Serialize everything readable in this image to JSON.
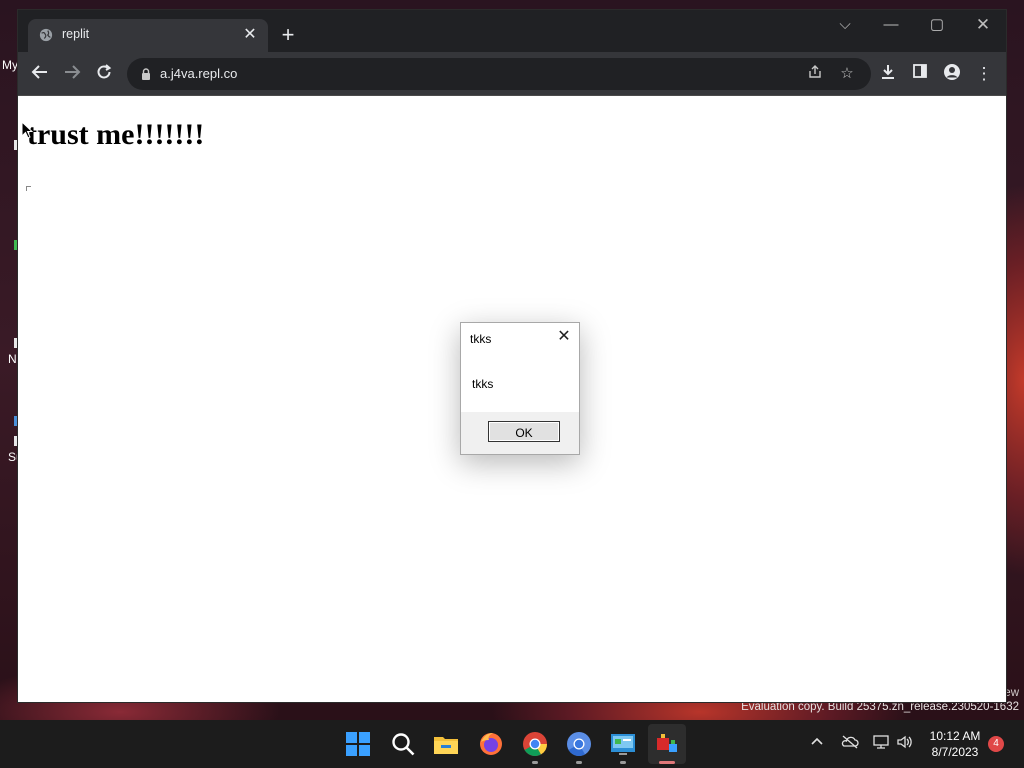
{
  "browser": {
    "tab": {
      "title": "replit",
      "icon": "globe-icon",
      "close_icon": "close-icon"
    },
    "new_tab_icon": "plus-icon",
    "window_controls": [
      "chevron-down-icon",
      "minimize-icon",
      "maximize-icon",
      "close-icon"
    ],
    "toolbar": {
      "back_icon": "back-arrow-icon",
      "forward_icon": "forward-arrow-icon",
      "reload_icon": "reload-icon",
      "url": "a.j4va.repl.co",
      "share_icon": "share-icon",
      "bookmark_icon": "star-icon",
      "download_icon": "download-icon",
      "sidepanel_icon": "side-panel-icon",
      "profile_icon": "profile-icon",
      "menu_icon": "kebab-menu-icon"
    }
  },
  "page": {
    "heading": "trust me!!!!!!!"
  },
  "dialog": {
    "title": "tkks",
    "message": "tkks",
    "ok_label": "OK"
  },
  "desktop": {
    "labels": [
      "My",
      "N",
      "Su"
    ],
    "watermark_line1": "ew",
    "watermark": "Evaluation copy. Build 25375.zn_release.230520-1632"
  },
  "taskbar": {
    "apps": [
      "windows-start-icon",
      "search-icon",
      "file-explorer-icon",
      "firefox-icon",
      "chrome-icon",
      "chromium-icon",
      "control-panel-icon",
      "app-icon"
    ],
    "tray": [
      "chevron-up-icon",
      "onedrive-offline-icon",
      "network-icon",
      "volume-icon"
    ],
    "time": "10:12 AM",
    "date": "8/7/2023",
    "notification_count": "4"
  },
  "colors": {
    "tabstrip_bg": "#202124",
    "toolbar_bg": "#35363a",
    "taskbar_bg": "#1c1c1c"
  }
}
